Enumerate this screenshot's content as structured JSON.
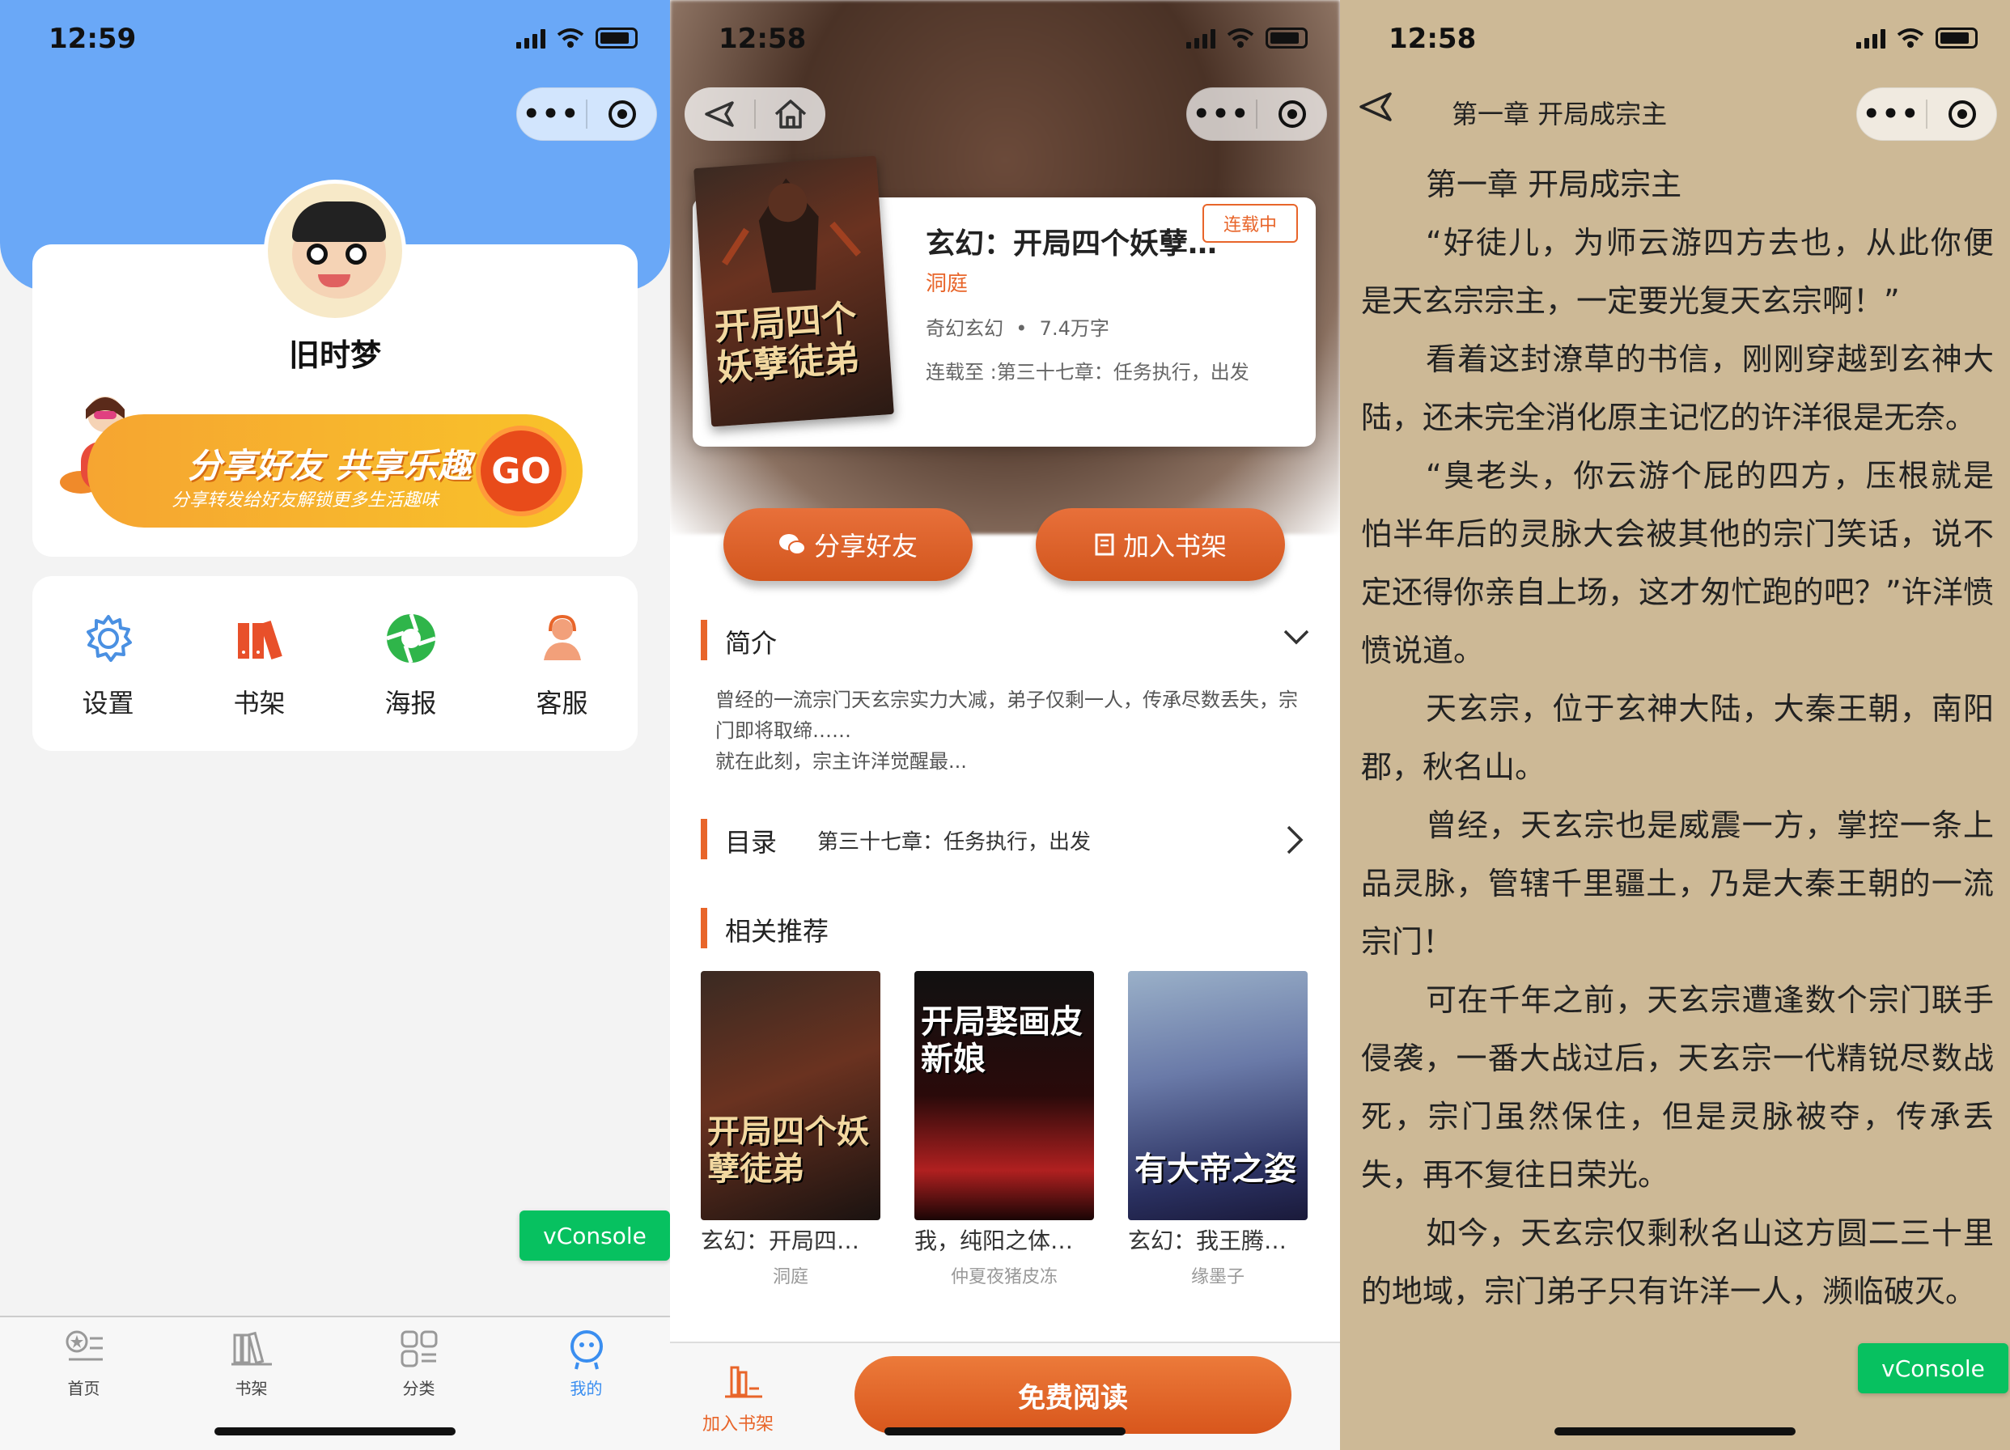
{
  "phone1": {
    "time": "12:59",
    "username": "旧时梦",
    "banner": {
      "title": "分享好友 共享乐趣",
      "subtitle": "分享转发给好友解锁更多生活趣味",
      "go": "GO"
    },
    "menu": [
      {
        "label": "设置",
        "icon": "gear-icon"
      },
      {
        "label": "书架",
        "icon": "bookshelf-icon"
      },
      {
        "label": "海报",
        "icon": "aperture-icon"
      },
      {
        "label": "客服",
        "icon": "customer-service-icon"
      }
    ],
    "vconsole": "vConsole",
    "tabs": [
      {
        "label": "首页",
        "icon": "home-icon",
        "active": false
      },
      {
        "label": "书架",
        "icon": "books-icon",
        "active": false
      },
      {
        "label": "分类",
        "icon": "category-icon",
        "active": false
      },
      {
        "label": "我的",
        "icon": "profile-icon",
        "active": true
      }
    ],
    "colors": {
      "header": "#6aa8f7",
      "active_tab": "#3a8ef0"
    }
  },
  "phone2": {
    "time": "12:58",
    "book": {
      "cover_title": "开局四个妖孽徒弟",
      "name": "玄幻：开局四个妖孽…",
      "author": "洞庭",
      "genre": "奇幻玄幻",
      "words": "7.4万字",
      "latest": "连载至 :第三十七章：任务执行，出发",
      "status": "连载中"
    },
    "share_btn": "分享好友",
    "shelf_btn": "加入书架",
    "intro": {
      "title": "简介",
      "text": "曾经的一流宗门天玄宗实力大减，弟子仅剩一人，传承尽数丢失，宗门即将取缔……",
      "text2": "就在此刻，宗主许洋觉醒最..."
    },
    "toc": {
      "title": "目录",
      "latest": "第三十七章：任务执行，出发"
    },
    "related": {
      "title": "相关推荐",
      "items": [
        {
          "name": "玄幻：开局四…",
          "author": "洞庭",
          "cover": "开局四个妖孽徒弟"
        },
        {
          "name": "我，纯阳之体…",
          "author": "仲夏夜猪皮冻",
          "cover": "开局娶画皮新娘"
        },
        {
          "name": "玄幻：我王腾…",
          "author": "缘墨子",
          "cover": "有大帝之姿"
        }
      ]
    },
    "bottom": {
      "shelf_label": "加入书架",
      "read_btn": "免费阅读"
    },
    "colors": {
      "accent": "#e8652a"
    }
  },
  "phone3": {
    "time": "12:58",
    "chapter_title": "第一章 开局成宗主",
    "heading": "第一章 开局成宗主",
    "paragraphs": [
      "“好徒儿，为师云游四方去也，从此你便是天玄宗宗主，一定要光复天玄宗啊！”",
      "看着这封潦草的书信，刚刚穿越到玄神大陆，还未完全消化原主记忆的许洋很是无奈。",
      "“臭老头，你云游个屁的四方，压根就是怕半年后的灵脉大会被其他的宗门笑话，说不定还得你亲自上场，这才匆忙跑的吧？”许洋愤愤说道。",
      "天玄宗，位于玄神大陆，大秦王朝，南阳郡，秋名山。",
      "曾经，天玄宗也是威震一方，掌控一条上品灵脉，管辖千里疆土，乃是大秦王朝的一流宗门！",
      "可在千年之前，天玄宗遭逢数个宗门联手侵袭，一番大战过后，天玄宗一代精锐尽数战死，宗门虽然保住，但是灵脉被夺，传承丢失，再不复往日荣光。",
      "如今，天玄宗仅剩秋名山这方圆二三十里的地域，宗门弟子只有许洋一人，濒临破灭。"
    ],
    "vconsole": "vConsole",
    "colors": {
      "paper": "#cdb996"
    }
  }
}
